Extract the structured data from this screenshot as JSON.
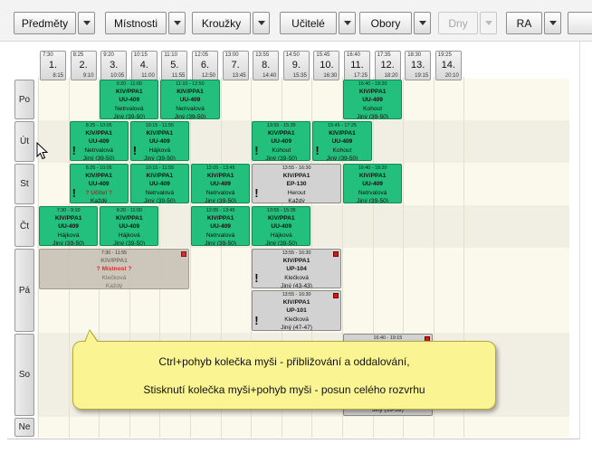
{
  "toolbar": {
    "buttons": [
      {
        "label": "Předměty",
        "enabled": true
      },
      {
        "label": "Místnosti",
        "enabled": true
      },
      {
        "label": "Kroužky",
        "enabled": true
      },
      {
        "label": "Učitelé",
        "enabled": true
      },
      {
        "label": "Obory",
        "enabled": true
      },
      {
        "label": "Dny",
        "enabled": false
      },
      {
        "label": "RA",
        "enabled": true
      }
    ]
  },
  "timeslots": [
    {
      "n": "1.",
      "start": "7:30",
      "end": "8:15"
    },
    {
      "n": "2.",
      "start": "8:25",
      "end": "9:10"
    },
    {
      "n": "3.",
      "start": "9:20",
      "end": "10:05"
    },
    {
      "n": "4.",
      "start": "10:15",
      "end": "11:00"
    },
    {
      "n": "5.",
      "start": "11:10",
      "end": "11:55"
    },
    {
      "n": "6.",
      "start": "12:05",
      "end": "12:50"
    },
    {
      "n": "7.",
      "start": "13:00",
      "end": "13:45"
    },
    {
      "n": "8.",
      "start": "13:55",
      "end": "14:40"
    },
    {
      "n": "9.",
      "start": "14:50",
      "end": "15:35"
    },
    {
      "n": "10.",
      "start": "15:45",
      "end": "16:30"
    },
    {
      "n": "11.",
      "start": "16:40",
      "end": "17:25"
    },
    {
      "n": "12.",
      "start": "17:35",
      "end": "18:20"
    },
    {
      "n": "13.",
      "start": "18:30",
      "end": "19:15"
    },
    {
      "n": "14.",
      "start": "19:25",
      "end": "20:10"
    }
  ],
  "days": [
    "Po",
    "Út",
    "St",
    "Čt",
    "Pá",
    "So",
    "Ne"
  ],
  "events": [
    {
      "time": "9:20 - 11:00",
      "course": "KIV/PPA1",
      "room": "UU-409",
      "teacher": "Netrvalová",
      "group": "Jiný (39-50)",
      "style": "green"
    },
    {
      "time": "11:10 - 12:50",
      "course": "KIV/PPA1",
      "room": "UU-409",
      "teacher": "Netrvalová",
      "group": "Jiný (39-50)",
      "style": "green"
    },
    {
      "time": "16:40 - 18:20",
      "course": "KIV/PPA1",
      "room": "UU-409",
      "teacher": "Kohout",
      "group": "Jiný (39-50)",
      "style": "green"
    },
    {
      "time": "8:25 - 10:05",
      "course": "KIV/PPA1",
      "room": "UU-409",
      "teacher": "Netrvalová",
      "group": "Jiný (39-50)",
      "style": "green",
      "warn": true
    },
    {
      "time": "10:15 - 11:55",
      "course": "KIV/PPA1",
      "room": "UU-409",
      "teacher": "Hájková",
      "group": "Jiný (39-50)",
      "style": "green",
      "warn": true
    },
    {
      "time": "13:55 - 15:35",
      "course": "KIV/PPA1",
      "room": "UU-409",
      "teacher": "Kohout",
      "group": "Jiný (39-50)",
      "style": "green",
      "warn": true
    },
    {
      "time": "15:45 - 17:25",
      "course": "KIV/PPA1",
      "room": "UU-409",
      "teacher": "Kohout",
      "group": "Jiný (39-50)",
      "style": "green",
      "warn": true
    },
    {
      "time": "8:25 - 10:05",
      "course": "KIV/PPA1",
      "room": "UU-409",
      "teacher": "? Učitel ?",
      "group": "Každý",
      "style": "green",
      "warn": true
    },
    {
      "time": "10:15 - 11:55",
      "course": "KIV/PPA1",
      "room": "UU-409",
      "teacher": "Netrvalová",
      "group": "Jiný (39-50)",
      "style": "green"
    },
    {
      "time": "12:05 - 13:45",
      "course": "KIV/PPA1",
      "room": "UU-409",
      "teacher": "Netrvalová",
      "group": "Jiný (39-50)",
      "style": "green"
    },
    {
      "time": "13:55 - 16:30",
      "course": "KIV/PPA1",
      "room": "EP-130",
      "teacher": "Herout",
      "group": "Každý",
      "style": "gray",
      "warn": true
    },
    {
      "time": "16:40 - 18:20",
      "course": "KIV/PPA1",
      "room": "UU-409",
      "teacher": "Netrvalová",
      "group": "Jiný (39-50)",
      "style": "green"
    },
    {
      "time": "7:30 - 9:10",
      "course": "KIV/PPA1",
      "room": "UU-409",
      "teacher": "Hájková",
      "group": "Jiný (39-50)",
      "style": "green"
    },
    {
      "time": "9:20 - 11:00",
      "course": "KIV/PPA1",
      "room": "UU-409",
      "teacher": "Hájková",
      "group": "Jiný (39-50)",
      "style": "green"
    },
    {
      "time": "12:05 - 13:45",
      "course": "KIV/PPA1",
      "room": "UU-409",
      "teacher": "Netrvalová",
      "group": "Jiný (39-50)",
      "style": "green"
    },
    {
      "time": "13:55 - 15:35",
      "course": "KIV/PPA1",
      "room": "UU-409",
      "teacher": "Hájková",
      "group": "Jiný (39-50)",
      "style": "green"
    },
    {
      "time": "7:30 - 11:55",
      "course": "KIV/PPA1",
      "room": "? Místnost ?",
      "teacher": "Klečková",
      "group": "Každý",
      "style": "light",
      "flag": true
    },
    {
      "time": "13:55 - 16:30",
      "course": "KIV/PPA1",
      "room": "UP-104",
      "teacher": "Klečková",
      "group": "Jiný (43-43)",
      "style": "gray",
      "flag": true,
      "warn": true
    },
    {
      "time": "13:55 - 16:30",
      "course": "KIV/PPA1",
      "room": "UP-101",
      "teacher": "Klečková",
      "group": "Jiný (47-47)",
      "style": "gray",
      "flag": true,
      "warn": true
    },
    {
      "time": "16:40 - 19:15",
      "course": "",
      "room": "",
      "teacher": "",
      "group": "Jiný (39-39)",
      "style": "gray",
      "flag": true
    }
  ],
  "tooltip": {
    "line1": "Ctrl+pohyb kolečka myši - přibližování a oddalování,",
    "line2": "Stisknutí kolečka myši+pohyb myši - posun celého rozvrhu"
  }
}
